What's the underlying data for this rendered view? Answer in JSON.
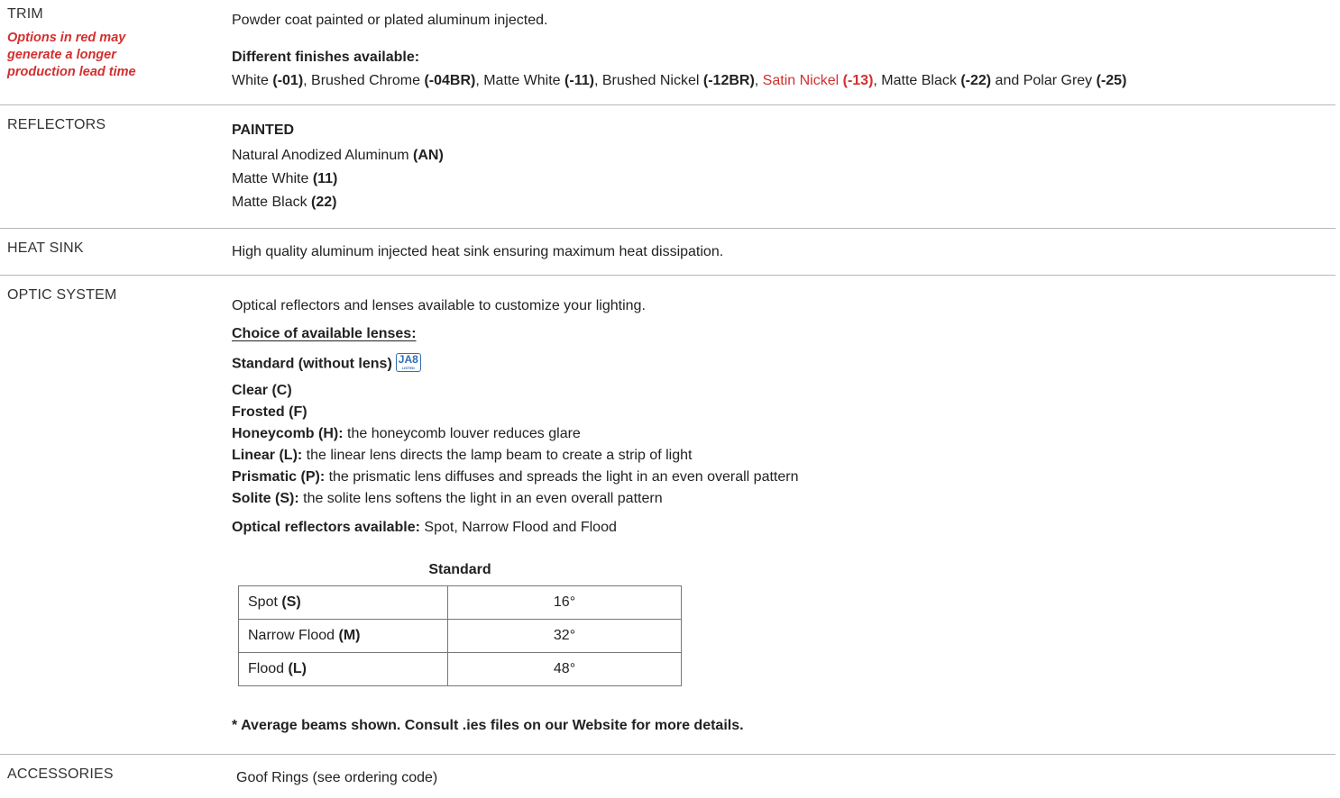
{
  "trim": {
    "label": "TRIM",
    "note": "Options in red may generate a longer production lead time",
    "description": "Powder coat painted or plated aluminum injected.",
    "finishes_heading": "Different finishes available:",
    "finishes": [
      {
        "name": "White",
        "code": "(-01)",
        "sep": ", "
      },
      {
        "name": "Brushed Chrome",
        "code": "(-04BR)",
        "sep": ", "
      },
      {
        "name": "Matte White",
        "code": "(-11)",
        "sep": ", "
      },
      {
        "name": "Brushed Nickel",
        "code": "(-12BR)",
        "sep": ", "
      },
      {
        "name": "Satin Nickel",
        "code": "(-13)",
        "sep": ", "
      },
      {
        "name": "Matte Black",
        "code": "(-22)",
        "sep": " and "
      },
      {
        "name": "Polar Grey",
        "code": "(-25)",
        "sep": ""
      }
    ]
  },
  "reflectors": {
    "label": "REFLECTORS",
    "heading": "PAINTED",
    "items": [
      {
        "name": "Natural Anodized Aluminum",
        "code": "(AN)"
      },
      {
        "name": "Matte White",
        "code": "(11)"
      },
      {
        "name": "Matte Black",
        "code": "(22)"
      }
    ]
  },
  "heat_sink": {
    "label": "HEAT SINK",
    "description": "High quality aluminum injected heat sink ensuring maximum heat dissipation."
  },
  "optic": {
    "label": "OPTIC SYSTEM",
    "intro": "Optical reflectors and lenses available to customize your lighting.",
    "lenses_heading": "Choice of available lenses:",
    "standard": "Standard (without lens)",
    "badge_big": "JA8",
    "badge_small": "LISTED",
    "lenses": [
      {
        "name": "Clear (C)",
        "desc": ""
      },
      {
        "name": "Frosted (F)",
        "desc": ""
      },
      {
        "name": "Honeycomb (H):",
        "desc": " the honeycomb louver reduces glare"
      },
      {
        "name": "Linear (L):",
        "desc": " the linear lens directs the lamp beam to create a strip of light"
      },
      {
        "name": "Prismatic (P):",
        "desc": " the prismatic lens diffuses and spreads the light in an even overall pattern"
      },
      {
        "name": "Solite (S):",
        "desc": " the solite lens softens the light in an even overall pattern"
      }
    ],
    "reflectors_label": "Optical reflectors available:",
    "reflectors_value": " Spot, Narrow Flood and Flood",
    "table_caption": "Standard",
    "table_rows": [
      {
        "name": "Spot",
        "code": "(S)",
        "value": "16°"
      },
      {
        "name": "Narrow Flood",
        "code": "(M)",
        "value": "32°"
      },
      {
        "name": "Flood",
        "code": "(L)",
        "value": "48°"
      }
    ],
    "footnote": "* Average beams shown. Consult .ies files on our Website for more details."
  },
  "accessories": {
    "label": "ACCESSORIES",
    "description": "Goof Rings (see ordering code)"
  },
  "colors": {
    "red_option": "#d32f2f",
    "badge": "#2f6eb5",
    "rule": "#b8b8b8"
  }
}
